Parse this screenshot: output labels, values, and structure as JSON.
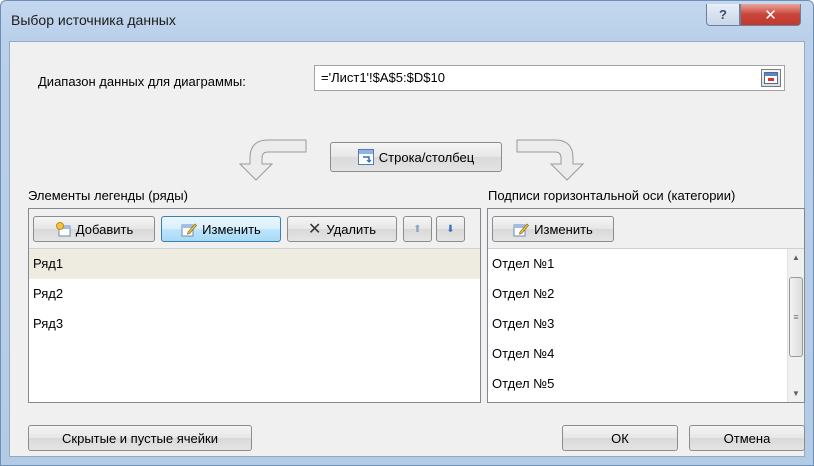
{
  "window": {
    "title": "Выбор источника данных",
    "help_glyph": "?",
    "close_glyph": "✕"
  },
  "range": {
    "label": "Диапазон данных для диаграммы:",
    "value": "='Лист1'!$A$5:$D$10"
  },
  "switch_button": {
    "label": "Строка/столбец",
    "icon": "switch-row-column-icon"
  },
  "legend": {
    "label": "Элементы легенды (ряды)",
    "add_label": "Добавить",
    "edit_label": "Изменить",
    "delete_label": "Удалить",
    "up_glyph": "⬆",
    "down_glyph": "⬇",
    "series": [
      "Ряд1",
      "Ряд2",
      "Ряд3"
    ],
    "selected_index": 0
  },
  "axis": {
    "label": "Подписи горизонтальной оси (категории)",
    "edit_label": "Изменить",
    "categories": [
      "Отдел №1",
      "Отдел №2",
      "Отдел №3",
      "Отдел №4",
      "Отдел №5"
    ]
  },
  "footer": {
    "hidden_cells_label": "Скрытые и пустые ячейки",
    "ok_label": "ОК",
    "cancel_label": "Отмена"
  },
  "colors": {
    "titlebar": "#b9cfea",
    "close_button": "#c8453a",
    "selection": "#eeebe0",
    "focus_border": "#3c7fb1"
  }
}
